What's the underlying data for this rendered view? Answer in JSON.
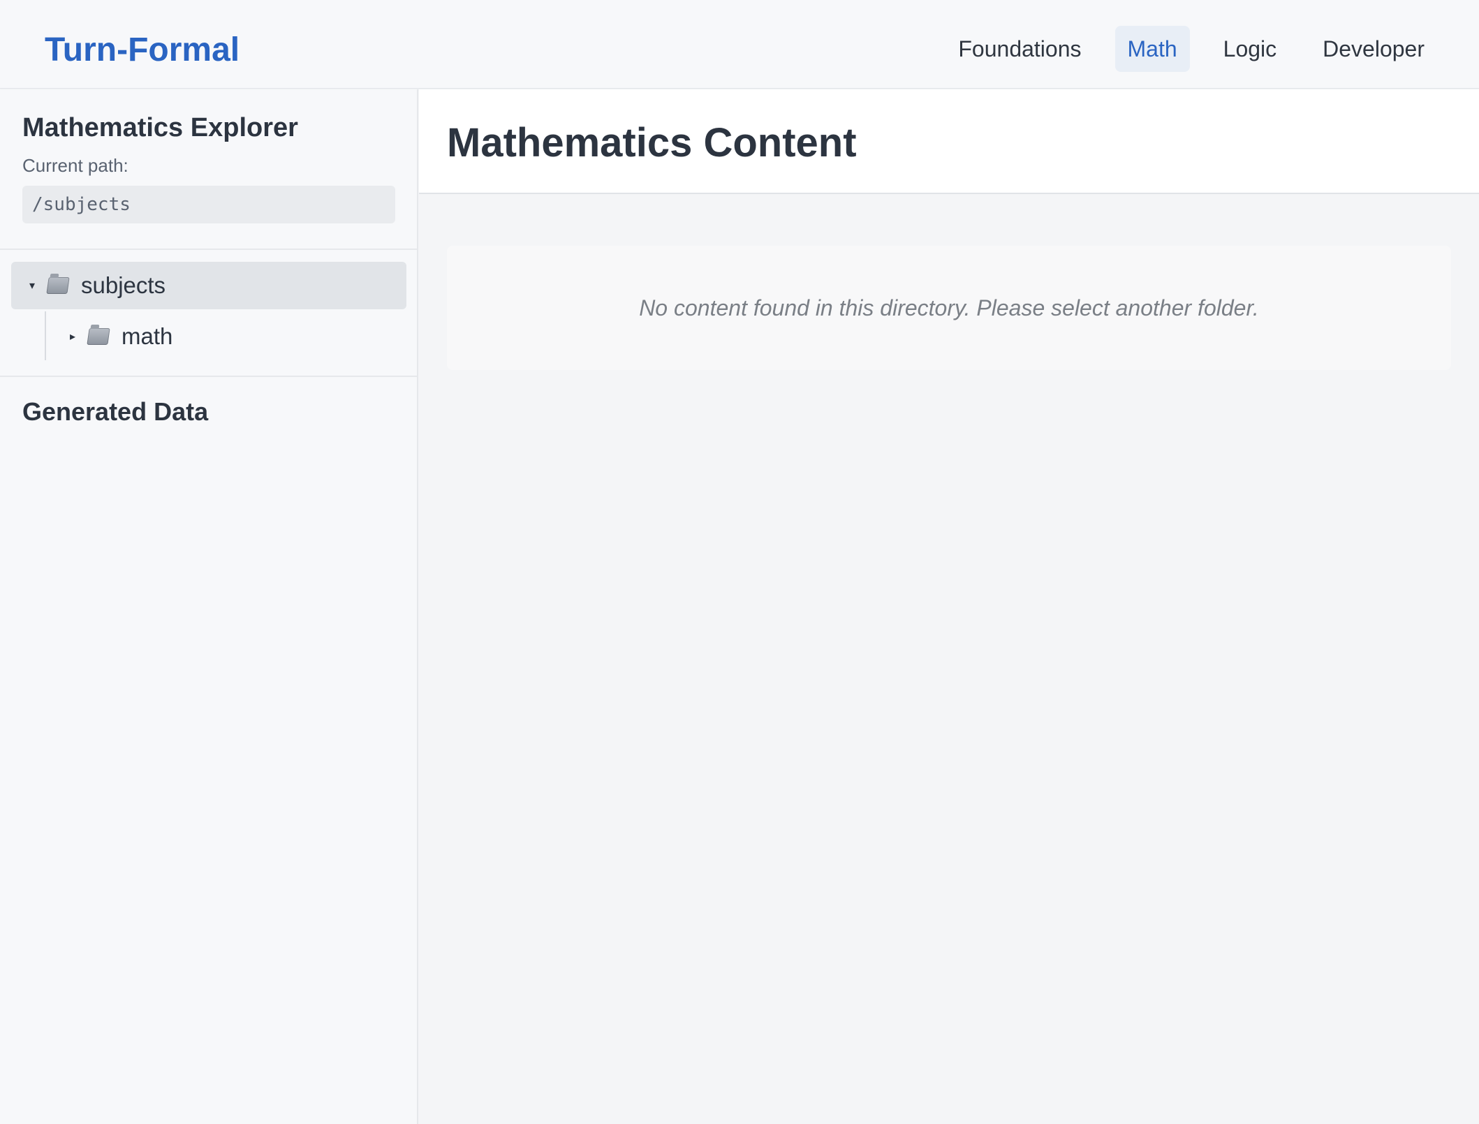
{
  "header": {
    "brand": "Turn-Formal",
    "nav": [
      {
        "label": "Foundations"
      },
      {
        "label": "Math"
      },
      {
        "label": "Logic"
      },
      {
        "label": "Developer"
      }
    ],
    "active_nav": "Math",
    "colors": {
      "brand": "#2a64c2",
      "active_bg": "#e8eef6"
    }
  },
  "sidebar": {
    "title": "Mathematics Explorer",
    "path_label": "Current path:",
    "path_value": "/subjects",
    "tree": [
      {
        "label": "subjects",
        "icon": "folder-icon",
        "expanded": true,
        "selected": true
      },
      {
        "label": "math",
        "icon": "folder-icon",
        "expanded": false,
        "selected": false
      }
    ],
    "generated_title": "Generated Data"
  },
  "main": {
    "title": "Mathematics Content",
    "empty_message": "No content found in this directory. Please select another folder."
  }
}
